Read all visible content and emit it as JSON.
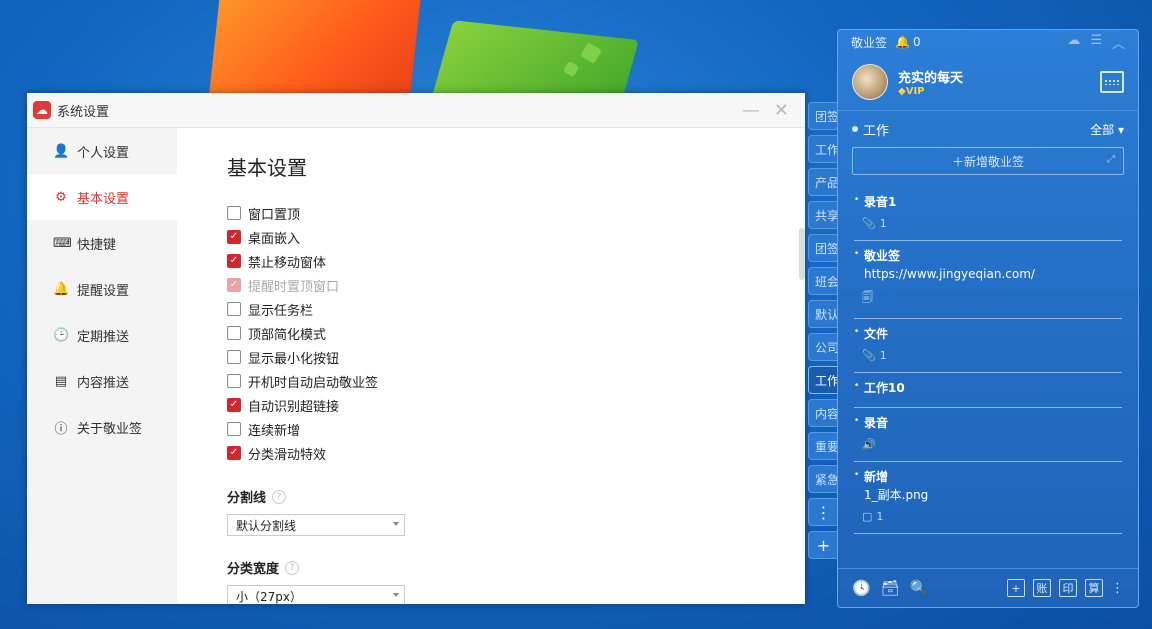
{
  "settings_window": {
    "title": "系统设置",
    "sidebar": [
      {
        "label": "个人设置",
        "icon": "person-icon",
        "glyph": "👤"
      },
      {
        "label": "基本设置",
        "icon": "settings-icon",
        "glyph": "⚙",
        "active": true
      },
      {
        "label": "快捷键",
        "icon": "keyboard-icon",
        "glyph": "⌨"
      },
      {
        "label": "提醒设置",
        "icon": "bell-icon",
        "glyph": "🔔"
      },
      {
        "label": "定期推送",
        "icon": "calendar-clock-icon",
        "glyph": "🕒"
      },
      {
        "label": "内容推送",
        "icon": "document-icon",
        "glyph": "▤"
      },
      {
        "label": "关于敬业签",
        "icon": "info-icon",
        "glyph": "ⓘ"
      }
    ],
    "page_title": "基本设置",
    "options": [
      {
        "label": "窗口置顶",
        "checked": false
      },
      {
        "label": "桌面嵌入",
        "checked": true
      },
      {
        "label": "禁止移动窗体",
        "checked": true
      },
      {
        "label": "提醒时置顶窗口",
        "checked": true,
        "disabled": true
      },
      {
        "label": "显示任务栏",
        "checked": false
      },
      {
        "label": "顶部简化模式",
        "checked": false
      },
      {
        "label": "显示最小化按钮",
        "checked": false
      },
      {
        "label": "开机时自动启动敬业签",
        "checked": false
      },
      {
        "label": "自动识别超链接",
        "checked": true
      },
      {
        "label": "连续新增",
        "checked": false
      },
      {
        "label": "分类滑动特效",
        "checked": true
      }
    ],
    "divider_label": "分割线",
    "divider_value": "默认分割线",
    "width_label": "分类宽度",
    "width_value": "小（27px）",
    "help_glyph": "?"
  },
  "category_tabs": [
    {
      "label": "团签"
    },
    {
      "label": "工作"
    },
    {
      "label": "产品"
    },
    {
      "label": "共享"
    },
    {
      "label": "团签"
    },
    {
      "label": "班会"
    },
    {
      "label": "默认"
    },
    {
      "label": "公司"
    },
    {
      "label": "工作",
      "active": true
    },
    {
      "label": "内容"
    },
    {
      "label": "重要"
    },
    {
      "label": "紧急"
    }
  ],
  "category_tools": {
    "more": "⋮",
    "add": "+"
  },
  "notes_panel": {
    "app_name": "敬业签",
    "reminder_count": "0",
    "user_name": "充实的每天",
    "vip_label": "VIP",
    "category": "工作",
    "filter": "全部",
    "new_note_label": "新增敬业签",
    "notes": [
      {
        "title": "录音1",
        "sub": "",
        "meta_icon": "📎",
        "meta": "1"
      },
      {
        "title": "敬业签",
        "sub": "https://www.jingyeqian.com/",
        "meta_icon": "🗐",
        "meta": ""
      },
      {
        "title": "文件",
        "sub": "",
        "meta_icon": "📎",
        "meta": "1"
      },
      {
        "title": "工作10",
        "sub": "",
        "meta_icon": "",
        "meta": ""
      },
      {
        "title": "录音",
        "sub": "",
        "meta_icon": "🔊",
        "meta": ""
      },
      {
        "title": "新增",
        "sub": "1_副本.png",
        "meta_icon": "▢",
        "meta": "1"
      }
    ],
    "footer_right": [
      "+",
      "账",
      "印",
      "算"
    ]
  }
}
